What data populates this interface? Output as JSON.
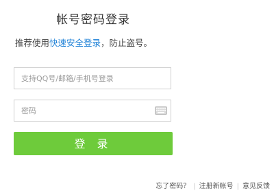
{
  "title": "帐号密码登录",
  "subtitle": {
    "prefix": "推荐使用",
    "link": "快速安全登录",
    "suffix": "，防止盗号。"
  },
  "account": {
    "placeholder": "支持QQ号/邮箱/手机号登录",
    "value": ""
  },
  "password": {
    "placeholder": "密码",
    "value": ""
  },
  "icons": {
    "keyboard": "keyboard-icon"
  },
  "login_button": "登 录",
  "footer": {
    "forgot": "忘了密码？",
    "separator": "|",
    "register": "注册新帐号",
    "feedback": "意见反馈"
  },
  "colors": {
    "button": "#6ecb3b",
    "link": "#1b7fd6"
  }
}
